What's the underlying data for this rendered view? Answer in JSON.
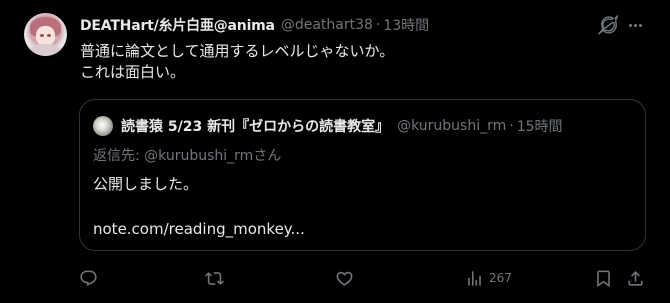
{
  "post": {
    "author": {
      "display_name": "DEATHart/糸片白亜@anima",
      "handle": "@deathart38",
      "time": "13時間"
    },
    "text_lines": [
      "普通に論文として通用するレベルじゃないか。",
      "これは面白い。"
    ],
    "quote": {
      "author": {
        "display_name": "読書猿 5/23 新刊『ゼロからの読書教室』",
        "handle": "@kurubushi_rm",
        "time": "15時間"
      },
      "reply_prefix": "返信先: ",
      "reply_handle": "@kurubushi_rm",
      "reply_suffix": "さん",
      "body_line1": "公開しました。",
      "body_line2": "note.com/reading_monkey..."
    },
    "actions": {
      "reply_icon": "reply-icon",
      "repost_icon": "repost-icon",
      "like_icon": "like-icon",
      "views_icon": "views-icon",
      "views_count": "267",
      "bookmark_icon": "bookmark-icon",
      "share_icon": "share-icon"
    }
  },
  "colors": {
    "background": "#000000",
    "text_primary": "#e7e9ea",
    "text_secondary": "#71767b",
    "border": "#2f3336"
  }
}
